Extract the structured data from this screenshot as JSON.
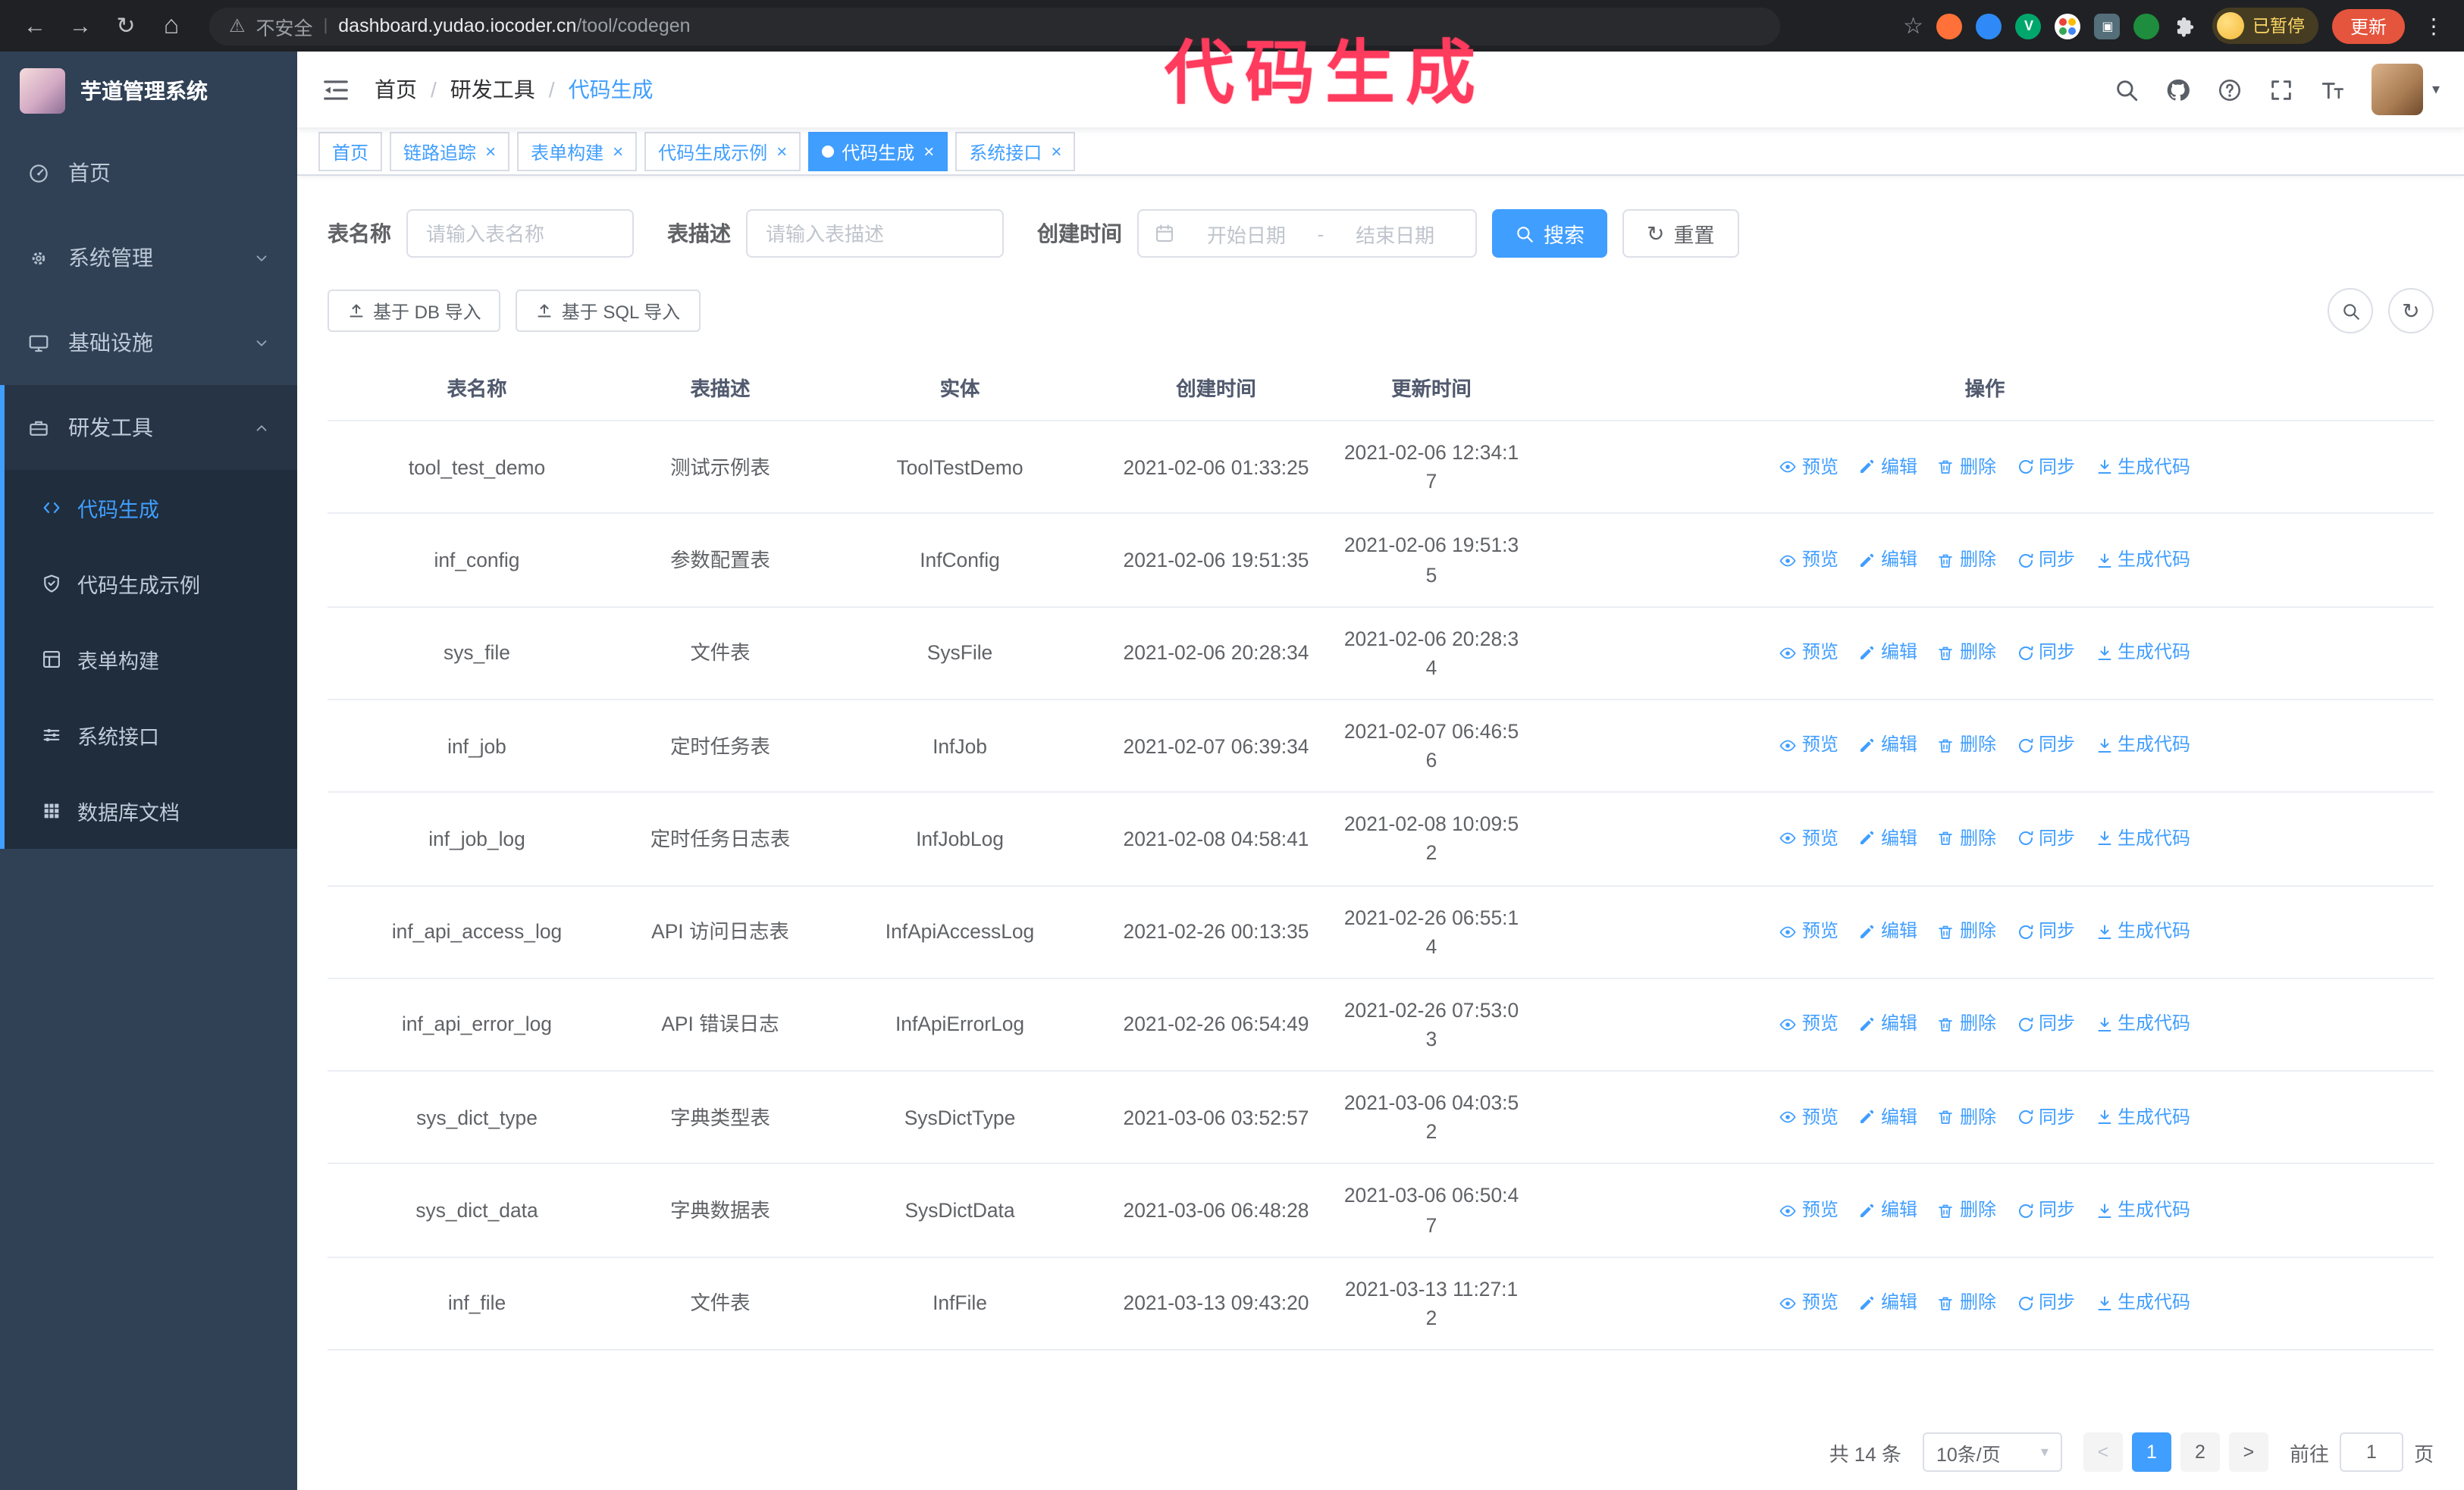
{
  "annotation": {
    "title": "代码生成"
  },
  "browser_chrome": {
    "security_label": "不安全",
    "url_domain": "dashboard.yudao.iocoder.cn",
    "url_path": "/tool/codegen",
    "paused_badge": "已暂停",
    "update_button": "更新",
    "extensions": [
      {
        "name": "orange-extension-icon",
        "color": "#ff7139"
      },
      {
        "name": "blue-extension-icon",
        "color": "#2f8af7"
      },
      {
        "name": "green-v-extension-icon",
        "color": "#00a76c",
        "glyph": "V"
      },
      {
        "name": "multicolor-extension-icon",
        "color": "multi"
      },
      {
        "name": "dark-extension-icon",
        "color": "#546e7a"
      },
      {
        "name": "green-leaf-extension-icon",
        "color": "#1e8e3e"
      },
      {
        "name": "puzzle-icon",
        "color": "#dadce0"
      }
    ]
  },
  "sidebar": {
    "logo_title": "芋道管理系统",
    "menu": [
      {
        "label": "首页",
        "icon": "dashboard-icon"
      },
      {
        "label": "系统管理",
        "icon": "gear-icon"
      },
      {
        "label": "基础设施",
        "icon": "infrastructure-icon"
      },
      {
        "label": "研发工具",
        "icon": "dev-tools-icon"
      }
    ],
    "submenu": [
      {
        "label": "代码生成",
        "icon": "code-icon",
        "active": true
      },
      {
        "label": "代码生成示例",
        "icon": "shield-icon",
        "active": false
      },
      {
        "label": "表单构建",
        "icon": "form-build-icon",
        "active": false
      },
      {
        "label": "系统接口",
        "icon": "api-sliders-icon",
        "active": false
      },
      {
        "label": "数据库文档",
        "icon": "db-doc-grid-icon",
        "active": false
      }
    ]
  },
  "header": {
    "breadcrumb": [
      {
        "label": "首页"
      },
      {
        "label": "研发工具"
      },
      {
        "label": "代码生成"
      }
    ]
  },
  "tags_view": [
    {
      "label": "首页",
      "closable": false,
      "active": false
    },
    {
      "label": "链路追踪",
      "closable": true,
      "active": false
    },
    {
      "label": "表单构建",
      "closable": true,
      "active": false
    },
    {
      "label": "代码生成示例",
      "closable": true,
      "active": false
    },
    {
      "label": "代码生成",
      "closable": true,
      "active": true
    },
    {
      "label": "系统接口",
      "closable": true,
      "active": false
    }
  ],
  "filters": {
    "table_name_label": "表名称",
    "table_name_placeholder": "请输入表名称",
    "table_desc_label": "表描述",
    "table_desc_placeholder": "请输入表描述",
    "create_time_label": "创建时间",
    "date_start_placeholder": "开始日期",
    "date_separator": "-",
    "date_end_placeholder": "结束日期",
    "search_button": "搜索",
    "reset_button": "重置"
  },
  "toolbar": {
    "import_db_button": "基于 DB 导入",
    "import_sql_button": "基于 SQL 导入"
  },
  "table": {
    "columns": [
      "表名称",
      "表描述",
      "实体",
      "创建时间",
      "更新时间",
      "操作"
    ],
    "action_labels": [
      "预览",
      "编辑",
      "删除",
      "同步",
      "生成代码"
    ],
    "rows": [
      {
        "name": "tool_test_demo",
        "desc": "测试示例表",
        "entity": "ToolTestDemo",
        "created": "2021-02-06 01:33:25",
        "updated": "2021-02-06 12:34:17"
      },
      {
        "name": "inf_config",
        "desc": "参数配置表",
        "entity": "InfConfig",
        "created": "2021-02-06 19:51:35",
        "updated": "2021-02-06 19:51:35"
      },
      {
        "name": "sys_file",
        "desc": "文件表",
        "entity": "SysFile",
        "created": "2021-02-06 20:28:34",
        "updated": "2021-02-06 20:28:34"
      },
      {
        "name": "inf_job",
        "desc": "定时任务表",
        "entity": "InfJob",
        "created": "2021-02-07 06:39:34",
        "updated": "2021-02-07 06:46:56"
      },
      {
        "name": "inf_job_log",
        "desc": "定时任务日志表",
        "entity": "InfJobLog",
        "created": "2021-02-08 04:58:41",
        "updated": "2021-02-08 10:09:52"
      },
      {
        "name": "inf_api_access_log",
        "desc": "API 访问日志表",
        "entity": "InfApiAccessLog",
        "created": "2021-02-26 00:13:35",
        "updated": "2021-02-26 06:55:14"
      },
      {
        "name": "inf_api_error_log",
        "desc": "API 错误日志",
        "entity": "InfApiErrorLog",
        "created": "2021-02-26 06:54:49",
        "updated": "2021-02-26 07:53:03"
      },
      {
        "name": "sys_dict_type",
        "desc": "字典类型表",
        "entity": "SysDictType",
        "created": "2021-03-06 03:52:57",
        "updated": "2021-03-06 04:03:52"
      },
      {
        "name": "sys_dict_data",
        "desc": "字典数据表",
        "entity": "SysDictData",
        "created": "2021-03-06 06:48:28",
        "updated": "2021-03-06 06:50:47"
      },
      {
        "name": "inf_file",
        "desc": "文件表",
        "entity": "InfFile",
        "created": "2021-03-13 09:43:20",
        "updated": "2021-03-13 11:27:12"
      }
    ]
  },
  "pagination": {
    "total_text": "共 14 条",
    "page_size_text": "10条/页",
    "pages": [
      {
        "label": "1",
        "active": true
      },
      {
        "label": "2",
        "active": false
      }
    ],
    "goto_label": "前往",
    "goto_value": "1",
    "goto_suffix": "页"
  },
  "colors": {
    "accent": "#409eff",
    "sidebar_bg": "#304156",
    "submenu_bg": "#1f2d3d",
    "annotation": "#ff3b5e",
    "update_button": "#e5543c"
  }
}
